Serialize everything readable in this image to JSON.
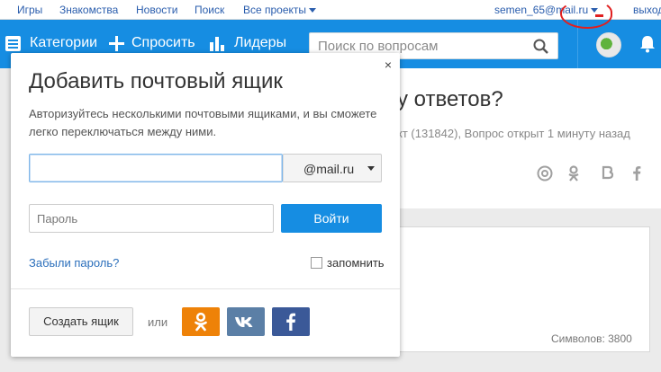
{
  "topbar": {
    "links": [
      "Игры",
      "Знакомства",
      "Новости",
      "Поиск"
    ],
    "all_projects": "Все проекты",
    "user_email": "semen_65@mail.ru",
    "logout": "выход"
  },
  "nav": {
    "categories": "Категории",
    "ask": "Спросить",
    "leaders": "Лидеры",
    "search_placeholder": "Поиск по вопросам"
  },
  "page": {
    "question_title_fragment": "у ответов?",
    "question_meta_fragment": "кт (131842), Вопрос открыт 1 минуту назад",
    "chars_counter": "Символов: 3800"
  },
  "modal": {
    "title": "Добавить почтовый ящик",
    "description": "Авторизуйтесь несколькими почтовыми ящиками, и вы сможете легко переключаться между ними.",
    "email_value": "",
    "domain": "@mail.ru",
    "password_placeholder": "Пароль",
    "login_button": "Войти",
    "forgot_link": "Забыли пароль?",
    "remember_label": "запомнить",
    "create_button": "Создать ящик",
    "or_label": "или",
    "close_glyph": "×"
  },
  "colors": {
    "nav_blue": "#168de2",
    "login_blue": "#168de2",
    "ok_orange": "#ee8208",
    "vk_blue": "#5b7fa6",
    "fb_blue": "#3b5998",
    "annotation_red": "#e02020"
  },
  "icons": {
    "categories": "grid-icon",
    "ask": "plus-icon",
    "leaders": "bar-chart-icon",
    "search": "search-icon",
    "bell": "bell-icon",
    "odnoklassniki": "odnoklassniki-icon",
    "vkontakte": "vk-icon",
    "facebook": "facebook-icon"
  }
}
